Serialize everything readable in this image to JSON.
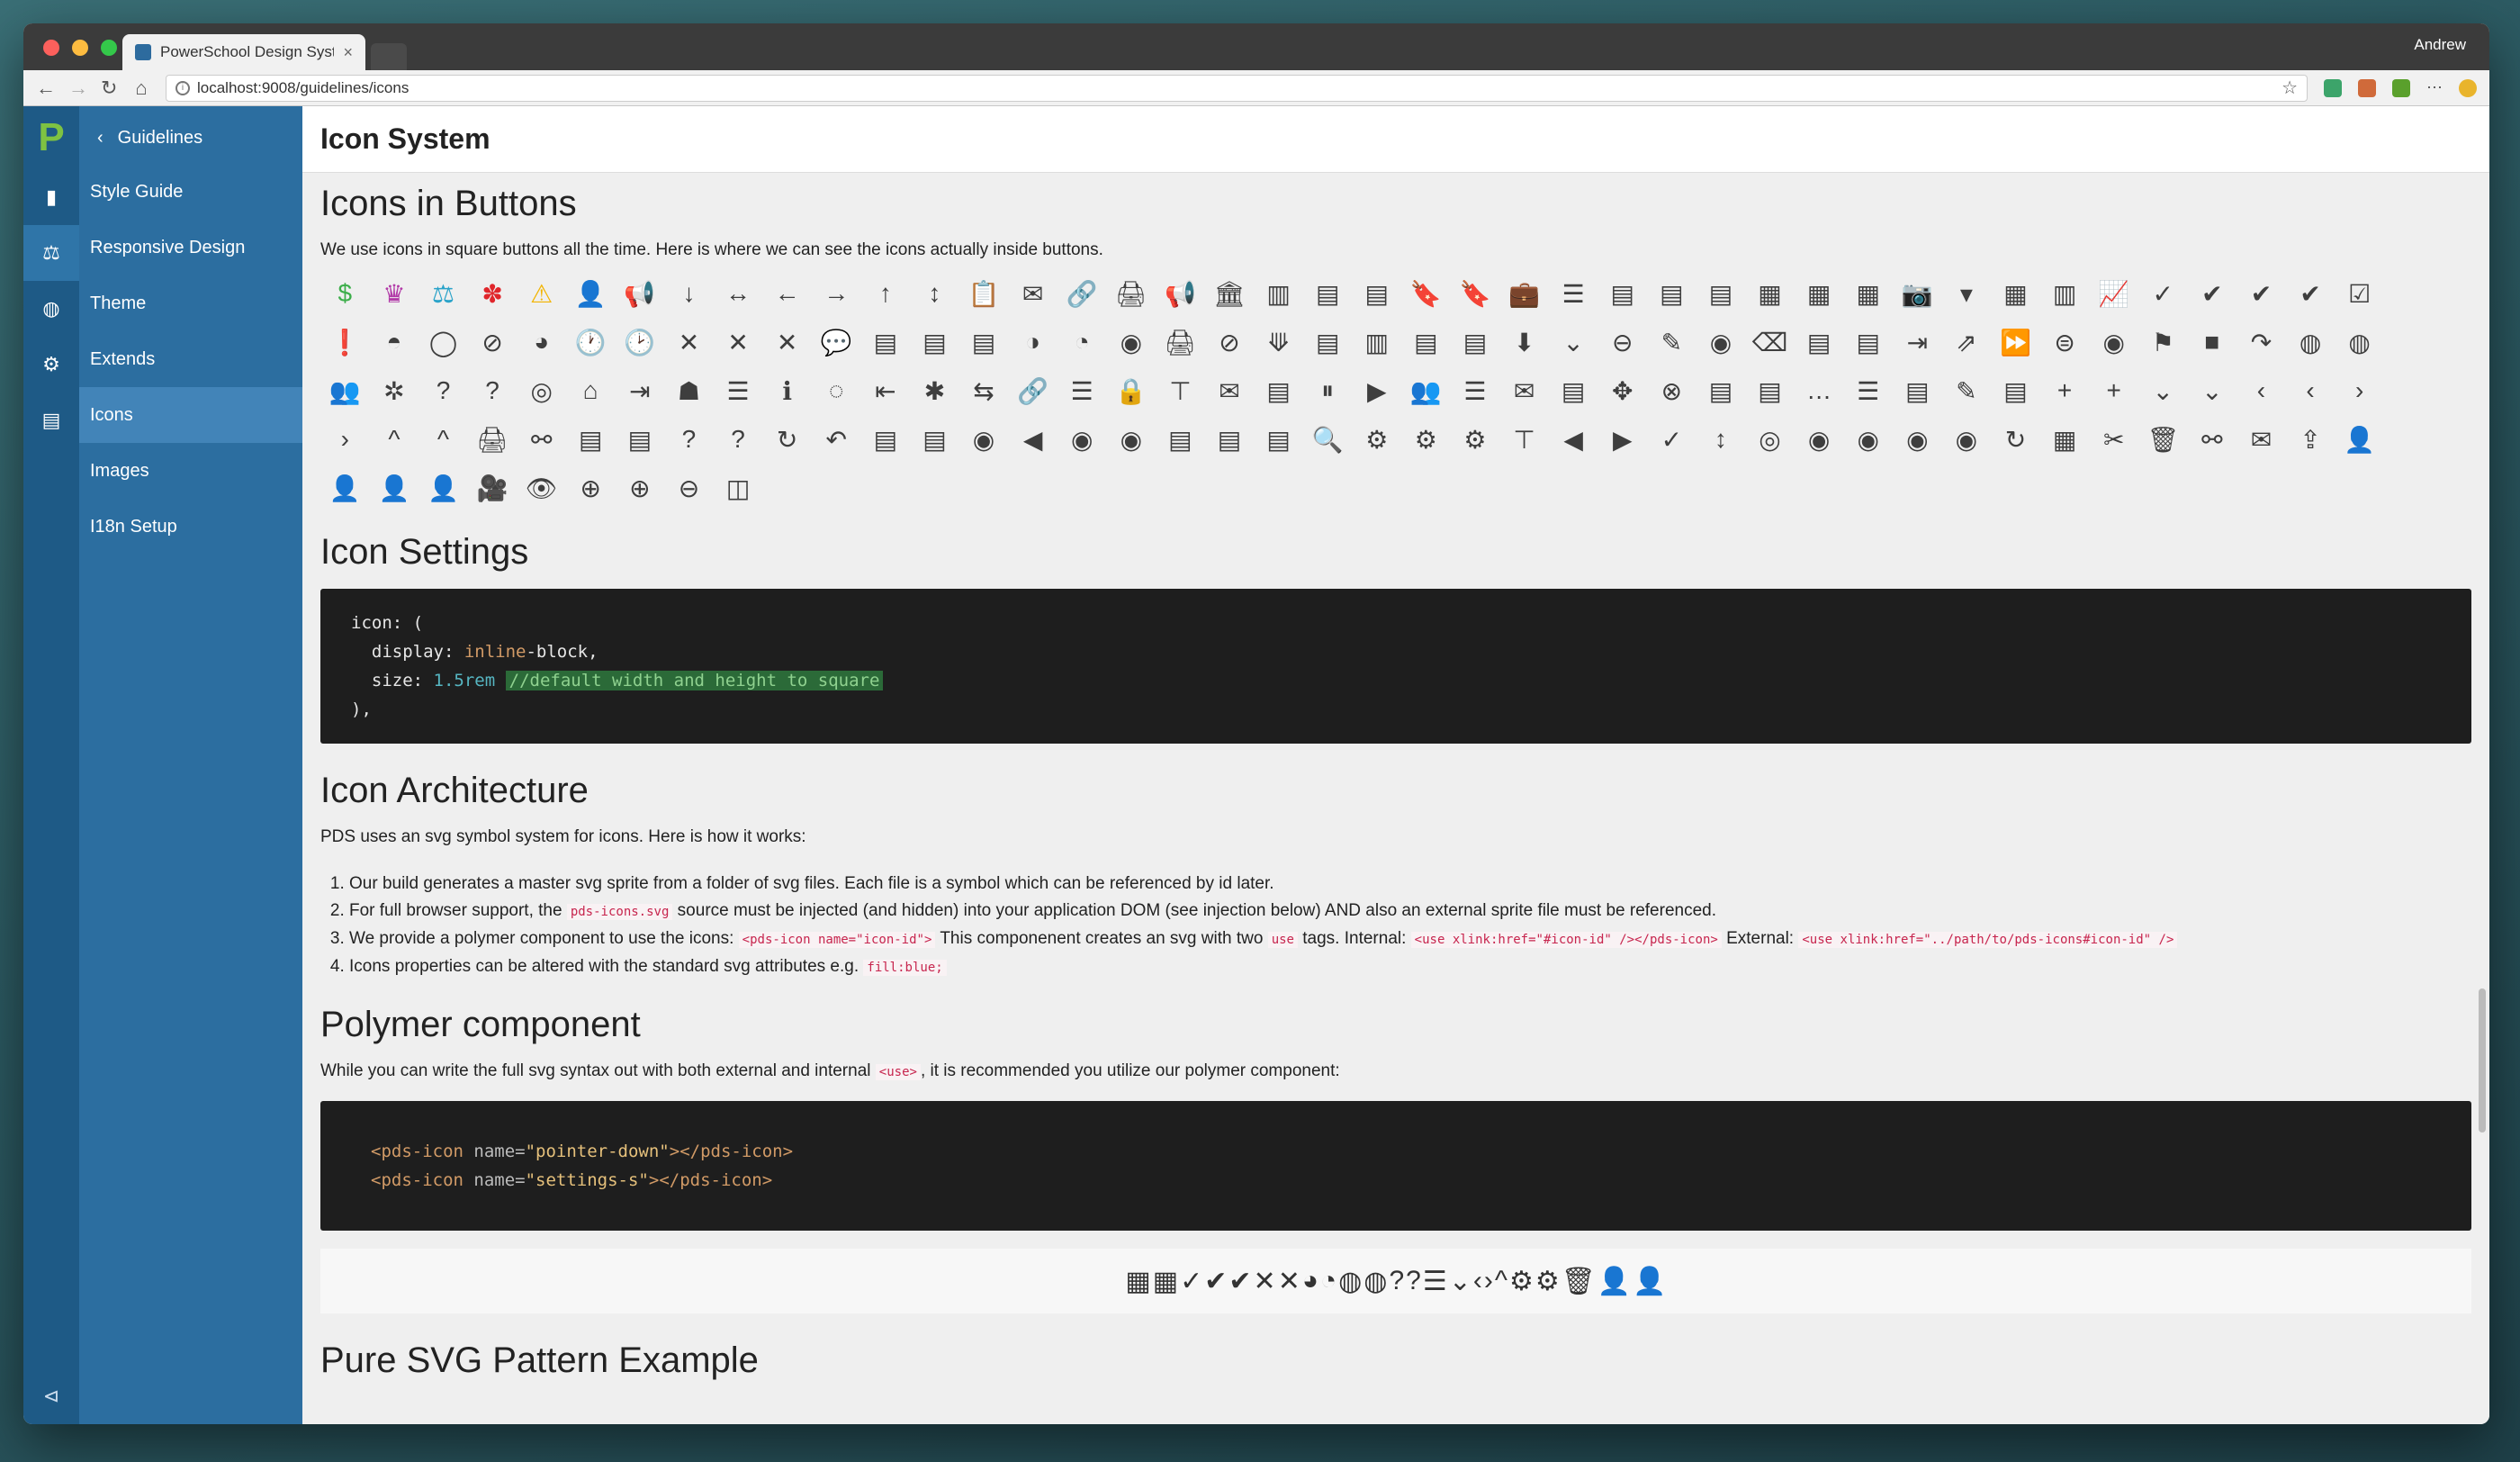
{
  "browser": {
    "tab_title": "PowerSchool Design System",
    "tab_close": "×",
    "user": "Andrew",
    "url": "localhost:9008/guidelines/icons"
  },
  "nav": {
    "back_label": "Guidelines",
    "items": [
      {
        "label": "Style Guide"
      },
      {
        "label": "Responsive Design"
      },
      {
        "label": "Theme"
      },
      {
        "label": "Extends"
      },
      {
        "label": "Icons"
      },
      {
        "label": "Images"
      },
      {
        "label": "I18n Setup"
      }
    ]
  },
  "page": {
    "title": "Icon System",
    "icons_in_buttons": {
      "heading": "Icons in Buttons",
      "intro": "We use icons in square buttons all the time. Here is where we can see the icons actually inside buttons.",
      "icons": [
        "$",
        "♛",
        "⚖",
        "✽",
        "⚠",
        "👤",
        "📢",
        "↓",
        "↔",
        "←",
        "→",
        "↑",
        "↕",
        "📋",
        "✉",
        "🔗",
        "🖨",
        "📢",
        "🏛",
        "▥",
        "▤",
        "▤",
        "🔖",
        "🔖",
        "💼",
        "☰",
        "▤",
        "▤",
        "▤",
        "▦",
        "▦",
        "▦",
        "📷",
        "▾",
        "▦",
        "▥",
        "📈",
        "✓",
        "✔",
        "✔",
        "✔",
        "☑",
        "❗",
        "◓",
        "◯",
        "⊘",
        "◕",
        "🕐",
        "🕑",
        "✕",
        "✕",
        "✕",
        "💬",
        "▤",
        "▤",
        "▤",
        "◑",
        "◔",
        "◉",
        "🖨",
        "⊘",
        "⟱",
        "▤",
        "▥",
        "▤",
        "▤",
        "⬇",
        "⌄",
        "⊖",
        "✎",
        "◉",
        "⌫",
        "▤",
        "▤",
        "⇥",
        "⇗",
        "⏩",
        "⊜",
        "◉",
        "⚑",
        "■",
        "↷",
        "◍",
        "◍",
        "👥",
        "✲",
        "?",
        "?",
        "◎",
        "⌂",
        "⇥",
        "☗",
        "☰",
        "ℹ",
        "◌",
        "⇤",
        "✱",
        "⇆",
        "🔗",
        "☰",
        "🔒",
        "⊤",
        "✉",
        "▤",
        "⏸",
        "▶",
        "👥",
        "☰",
        "✉",
        "▤",
        "✥",
        "⊗",
        "▤",
        "▤",
        "…",
        "☰",
        "▤",
        "✎",
        "▤",
        "+",
        "+",
        "⌄",
        "⌄",
        "‹",
        "‹",
        "›",
        "›",
        "^",
        "^",
        "🖨",
        "⚯",
        "▤",
        "▤",
        "?",
        "?",
        "↻",
        "↶",
        "▤",
        "▤",
        "◉",
        "◀",
        "◉",
        "◉",
        "▤",
        "▤",
        "▤",
        "🔍",
        "⚙",
        "⚙",
        "⚙",
        "⊤",
        "◀",
        "▶",
        "✓",
        "↕",
        "◎",
        "◉",
        "◉",
        "◉",
        "◉",
        "↻",
        "▦",
        "✂",
        "🗑",
        "⚯",
        "✉",
        "⇪",
        "👤",
        "👤",
        "👤",
        "👤",
        "🎥",
        "👁",
        "⊕",
        "⊕",
        "⊖",
        "◫"
      ]
    },
    "icon_settings": {
      "heading": "Icon Settings",
      "line1": "icon: (",
      "line2_prop": "display: ",
      "line2_val": "inline",
      "line2_rest": "-block,",
      "line3_prop": "size: ",
      "line3_val": "1.5rem",
      "line3_comment": "//default width and height to square",
      "line4": "),"
    },
    "architecture": {
      "heading": "Icon Architecture",
      "intro": "PDS uses an svg symbol system for icons. Here is how it works:",
      "item1": "Our build generates a master svg sprite from a folder of svg files. Each file is a symbol which can be referenced by id later.",
      "item2_a": "For full browser support, the ",
      "item2_code": "pds-icons.svg",
      "item2_b": " source must be injected (and hidden) into your application DOM (see injection below) AND also an external sprite file must be referenced.",
      "item3_a": "We provide a polymer component to use the icons: ",
      "item3_code1": "<pds-icon name=\"icon-id\">",
      "item3_b": " This componenent creates an svg with two ",
      "item3_code2": "use",
      "item3_c": " tags. Internal: ",
      "item3_code3": "<use xlink:href=\"#icon-id\" /></pds-icon>",
      "item3_d": " External: ",
      "item3_code4": "<use xlink:href=\"../path/to/pds-icons#icon-id\" />",
      "item4_a": "Icons properties can be altered with the standard svg attributes e.g. ",
      "item4_code": "fill:blue;"
    },
    "polymer": {
      "heading": "Polymer component",
      "intro_a": "While you can write the full svg syntax out with both external and internal ",
      "intro_code": "<use>",
      "intro_b": ", it is recommended you utilize our polymer component:",
      "code_line1_open": "<pds-icon ",
      "code_line1_attr": "name=",
      "code_line1_val": "\"pointer-down\"",
      "code_line1_close": "></pds-icon>",
      "code_line2_open": "<pds-icon ",
      "code_line2_attr": "name=",
      "code_line2_val": "\"settings-s\"",
      "code_line2_close": "></pds-icon>",
      "preview_icons": [
        "▦",
        "▦",
        "✓",
        "✔",
        "✔",
        "✕",
        "✕",
        "◕",
        "◔",
        "◍",
        "◍",
        "?",
        "?",
        "☰",
        "⌄",
        "‹",
        "›",
        "^",
        "⚙",
        "⚙",
        "🗑",
        "👤",
        "👤"
      ]
    },
    "next_section_partial": "Pure SVG Pattern Example"
  },
  "colors": {
    "rail": "#1e5a86",
    "sidebar": "#2c6ea0",
    "sidebar_active": "#4284b8",
    "logo": "#7ec242"
  }
}
